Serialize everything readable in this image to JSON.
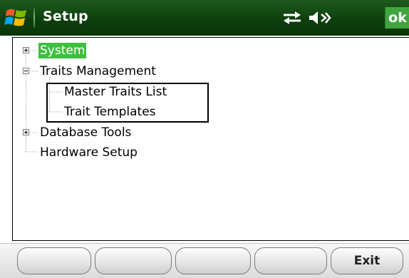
{
  "titlebar": {
    "title": "Setup",
    "ok_label": "ok",
    "icons": [
      "windows-start-icon",
      "connectivity-icon",
      "volume-off-icon"
    ],
    "background": "#0d3f0d",
    "ok_color": "#3fa63f"
  },
  "tree": {
    "selected_color": "#3fbf3f",
    "nodes": [
      {
        "label": "System",
        "expander": "plus",
        "selected": true
      },
      {
        "label": "Traits Management",
        "expander": "minus",
        "selected": false
      },
      {
        "label": "Master Traits List",
        "expander": null,
        "selected": false
      },
      {
        "label": "Trait Templates",
        "expander": null,
        "selected": false
      },
      {
        "label": "Database Tools",
        "expander": "plus",
        "selected": false
      },
      {
        "label": "Hardware Setup",
        "expander": null,
        "selected": false
      }
    ]
  },
  "softkeys": {
    "labels": [
      "",
      "",
      "",
      "",
      "Exit"
    ]
  }
}
